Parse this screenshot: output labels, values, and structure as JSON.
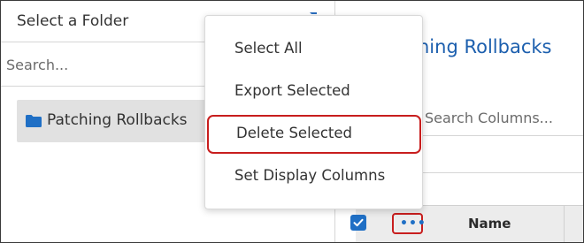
{
  "left_panel": {
    "title": "Select a Folder",
    "search_placeholder": "Search...",
    "folders": [
      {
        "label": "Patching Rollbacks"
      }
    ]
  },
  "right_panel": {
    "title": "Patching Rollbacks",
    "title_visible": "hing Rollbacks",
    "column_search_placeholder": "Search Columns...",
    "table": {
      "columns": [
        {
          "label": "Name"
        }
      ],
      "more_button_label": "•••"
    }
  },
  "context_menu": {
    "items": [
      {
        "label": "Select All"
      },
      {
        "label": "Export Selected"
      },
      {
        "label": "Delete Selected",
        "highlighted": true
      },
      {
        "label": "Set Display Columns"
      }
    ]
  },
  "colors": {
    "accent": "#1f6fc5",
    "title_blue": "#1c5fae",
    "highlight_border": "#c81e1e",
    "folder_bg": "#e1e1e1"
  },
  "icons": {
    "folder": "folder-icon",
    "more": "more-horizontal-icon",
    "check": "checkmark-icon"
  }
}
